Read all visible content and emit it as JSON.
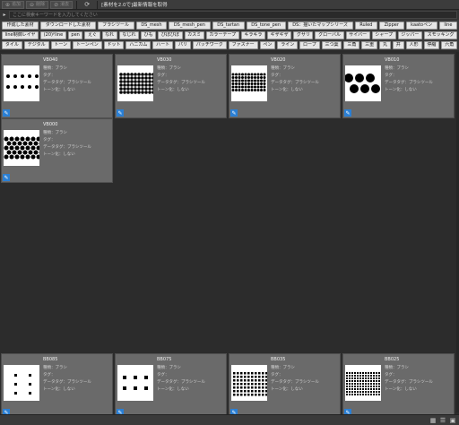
{
  "toolbar": {
    "btn1": "追加",
    "btn2": "削除",
    "btn3": "消去",
    "status_text": "[素材を2.0で]最新情報を取得"
  },
  "search": {
    "placeholder": "ここに検索キーワードを入力してください"
  },
  "tags": [
    [
      "作成した素材",
      "ダウンロードした素材",
      "ブラシツール",
      "DS_mesh",
      "DS_mesh_pen",
      "DS_tartan",
      "DS_tone_pen",
      "DS：描いたマップシリーズ",
      "Ruled",
      "Zipper",
      "kaatoペン",
      "line"
    ],
    [
      "line制御レイヤ",
      "(20)ᵖline",
      "pen",
      "えぐ",
      "なれ",
      "なじれ",
      "ひも",
      "ぴぽぴぽ",
      "カスミ",
      "カラーテープ",
      "キラキラ",
      "ギザギザ",
      "グサリ",
      "グローバル",
      "サイバー",
      "シャープ",
      "ジッパー",
      "スモッキング"
    ],
    [
      "タイル",
      "デジタル",
      "トーン",
      "トーンペン",
      "ドット",
      "ハニカム",
      "ハート",
      "パリ",
      "パッチワーク",
      "ファスナー",
      "ペン",
      "ライン",
      "ロープ",
      "三つ葉",
      "三角",
      "三重",
      "丸",
      "井",
      "人形",
      "停縮",
      "六角"
    ]
  ],
  "cards": [
    {
      "name": "VB040",
      "meta": [
        "種類：ブラシ",
        "タグ：",
        "データタグ：ブラシツール",
        "トーン化：しない"
      ],
      "pattern": "dots-sparse"
    },
    {
      "name": "VB030",
      "meta": [
        "種類：ブラシ",
        "タグ：",
        "データタグ：ブラシツール",
        "トーン化：しない"
      ],
      "pattern": "dots-band"
    },
    {
      "name": "VB020",
      "meta": [
        "種類：ブラシ",
        "タグ：",
        "データタグ：ブラシツール",
        "トーン化：しない"
      ],
      "pattern": "dots-dense"
    },
    {
      "name": "VB010",
      "meta": [
        "種類：ブラシ",
        "タグ：",
        "データタグ：ブラシツール",
        "トーン化：しない"
      ],
      "pattern": "dots-large"
    },
    {
      "name": "VB000",
      "meta": [
        "種類：ブラシ",
        "タグ：",
        "データタグ：ブラシツール",
        "トーン化：しない"
      ],
      "pattern": "dots-mixed"
    },
    {
      "name": "BB085",
      "meta": [
        "種類：ブラシ",
        "タグ：",
        "データタグ：ブラシツール",
        "トーン化：しない"
      ],
      "pattern": "sq-sparse"
    },
    {
      "name": "BB075",
      "meta": [
        "種類：ブラシ",
        "タグ：",
        "データタグ：ブラシツール",
        "トーン化：しない"
      ],
      "pattern": "sq-mid"
    },
    {
      "name": "BB035",
      "meta": [
        "種類：ブラシ",
        "タグ：",
        "データタグ：ブラシツール",
        "トーン化：しない"
      ],
      "pattern": "sq-dense"
    },
    {
      "name": "BB025",
      "meta": [
        "種類：ブラシ",
        "タグ：",
        "データタグ：ブラシツール",
        "トーン化：しない"
      ],
      "pattern": "sq-very-dense"
    }
  ],
  "icons": {
    "pen": "brush-pen-icon",
    "refresh": "refresh-icon"
  },
  "colors": {
    "pen_icon_bg": "#2a7fd4",
    "card_bg": "#6a6a6a"
  }
}
